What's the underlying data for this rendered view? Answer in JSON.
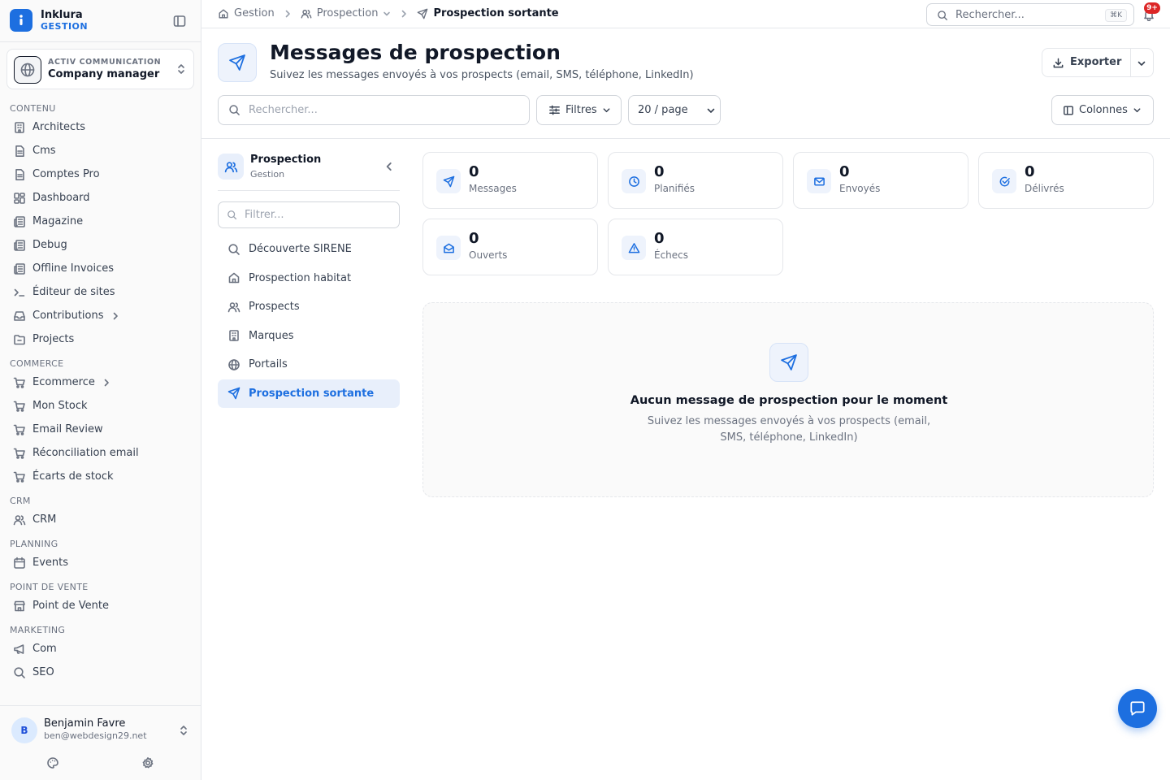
{
  "brand": {
    "name": "Inklura",
    "subtitle": "GESTION"
  },
  "company": {
    "org": "ACTIV COMMUNICATION",
    "role": "Company manager"
  },
  "sidebar": {
    "sections": [
      {
        "title": "CONTENU",
        "items": [
          {
            "label": "Architects",
            "icon": "building-icon"
          },
          {
            "label": "Cms",
            "icon": "file-icon"
          },
          {
            "label": "Comptes Pro",
            "icon": "file-icon"
          },
          {
            "label": "Dashboard",
            "icon": "grid-icon"
          },
          {
            "label": "Magazine",
            "icon": "newspaper-icon"
          },
          {
            "label": "Debug",
            "icon": "newspaper-icon"
          },
          {
            "label": "Offline Invoices",
            "icon": "newspaper-icon"
          },
          {
            "label": "Éditeur de sites",
            "icon": "terminal-icon"
          },
          {
            "label": "Contributions",
            "icon": "inbox-icon",
            "has_children": true
          },
          {
            "label": "Projects",
            "icon": "folder-icon"
          }
        ]
      },
      {
        "title": "COMMERCE",
        "items": [
          {
            "label": "Ecommerce",
            "icon": "cart-icon",
            "has_children": true
          },
          {
            "label": "Mon Stock",
            "icon": "cart-icon"
          },
          {
            "label": "Email Review",
            "icon": "cart-icon"
          },
          {
            "label": "Réconciliation email",
            "icon": "cart-icon"
          },
          {
            "label": "Écarts de stock",
            "icon": "cart-icon"
          }
        ]
      },
      {
        "title": "CRM",
        "items": [
          {
            "label": "CRM",
            "icon": "users-icon"
          }
        ]
      },
      {
        "title": "PLANNING",
        "items": [
          {
            "label": "Events",
            "icon": "calendar-icon"
          }
        ]
      },
      {
        "title": "POINT DE VENTE",
        "items": [
          {
            "label": "Point de Vente",
            "icon": "store-icon"
          }
        ]
      },
      {
        "title": "MARKETING",
        "items": [
          {
            "label": "Com",
            "icon": "megaphone-icon"
          },
          {
            "label": "SEO",
            "icon": "search-icon"
          }
        ]
      }
    ]
  },
  "user": {
    "initial": "B",
    "name": "Benjamin Favre",
    "email": "ben@webdesign29.net"
  },
  "breadcrumb": [
    {
      "label": "Gestion",
      "icon": "home-icon"
    },
    {
      "label": "Prospection",
      "icon": "users-icon",
      "dropdown": true
    },
    {
      "label": "Prospection sortante",
      "icon": "send-icon",
      "current": true
    }
  ],
  "topbar": {
    "search_placeholder": "Rechercher...",
    "shortcut": "⌘K",
    "notifications_badge": "9+"
  },
  "page": {
    "title": "Messages de prospection",
    "subtitle": "Suivez les messages envoyés à vos prospects (email, SMS, téléphone, LinkedIn)",
    "export_label": "Exporter"
  },
  "toolbar": {
    "search_placeholder": "Rechercher...",
    "filters_label": "Filtres",
    "per_page_label": "20 / page",
    "columns_label": "Colonnes"
  },
  "subnav": {
    "title": "Prospection",
    "subtitle": "Gestion",
    "filter_placeholder": "Filtrer...",
    "items": [
      {
        "label": "Découverte SIRENE",
        "icon": "search-icon"
      },
      {
        "label": "Prospection habitat",
        "icon": "home-icon"
      },
      {
        "label": "Prospects",
        "icon": "users-icon"
      },
      {
        "label": "Marques",
        "icon": "building-icon"
      },
      {
        "label": "Portails",
        "icon": "globe-icon"
      },
      {
        "label": "Prospection sortante",
        "icon": "send-icon",
        "active": true
      }
    ]
  },
  "stats": [
    {
      "value": "0",
      "label": "Messages",
      "icon": "send-icon"
    },
    {
      "value": "0",
      "label": "Planifiés",
      "icon": "clock-icon"
    },
    {
      "value": "0",
      "label": "Envoyés",
      "icon": "mail-icon"
    },
    {
      "value": "0",
      "label": "Délivrés",
      "icon": "check-circle-icon"
    },
    {
      "value": "0",
      "label": "Ouverts",
      "icon": "mail-open-icon"
    },
    {
      "value": "0",
      "label": "Échecs",
      "icon": "alert-triangle-icon"
    }
  ],
  "empty_state": {
    "title": "Aucun message de prospection pour le moment",
    "description": "Suivez les messages envoyés à vos prospects (email, SMS, téléphone, LinkedIn)"
  },
  "colors": {
    "accent": "#1d6fe0",
    "badge": "#dc2626"
  }
}
